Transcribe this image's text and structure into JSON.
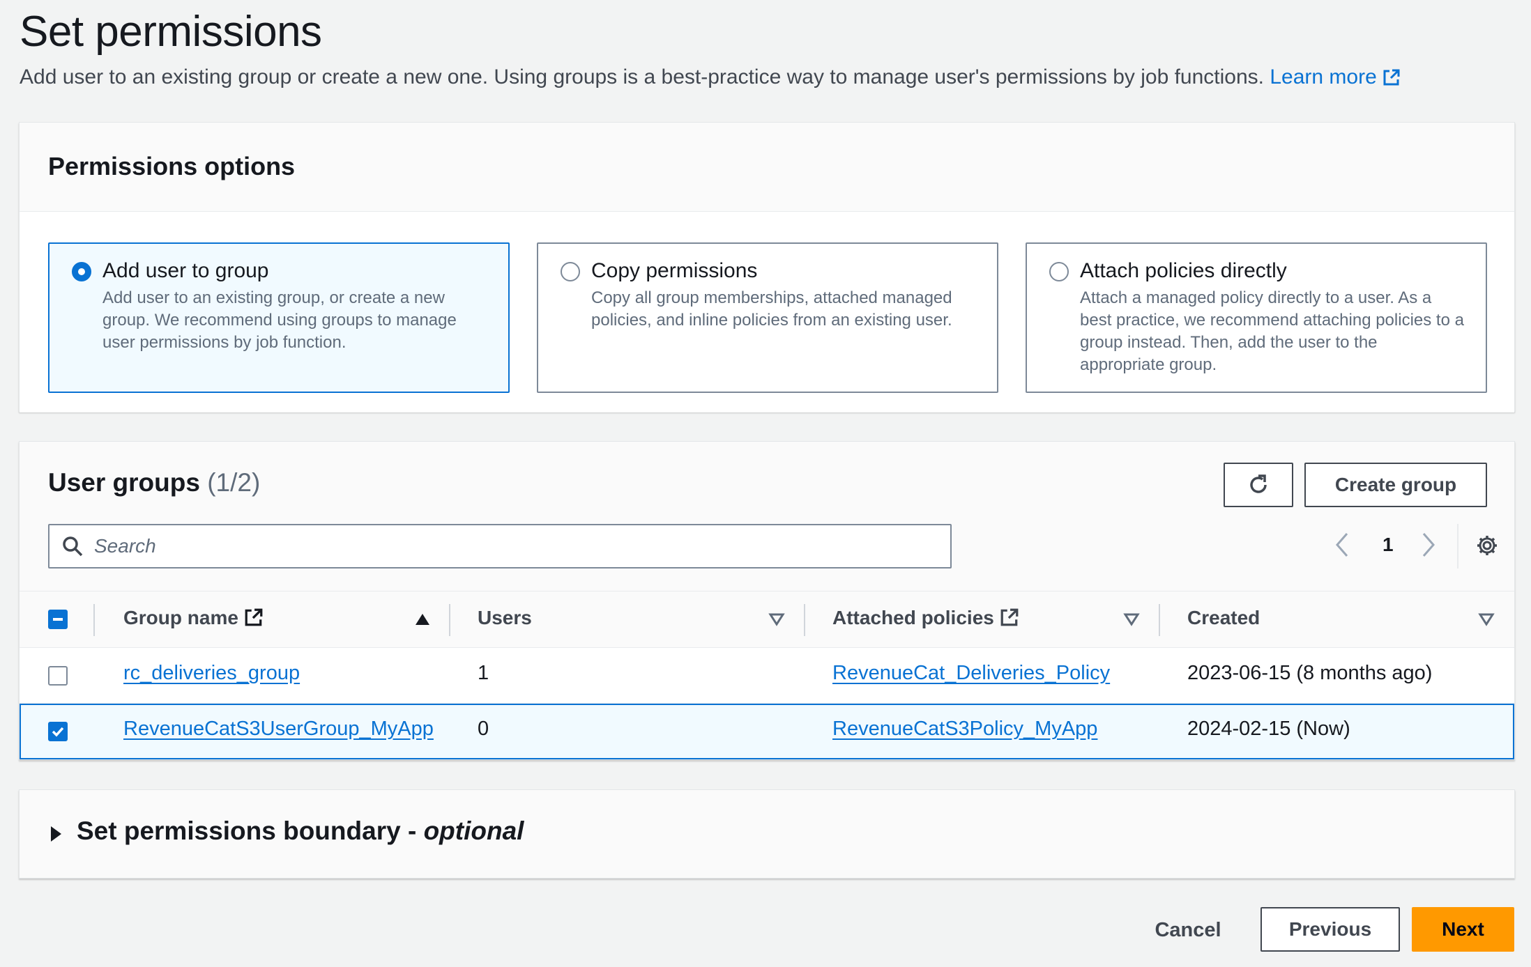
{
  "header": {
    "title": "Set permissions",
    "description": "Add user to an existing group or create a new one. Using groups is a best-practice way to manage user's permissions by job functions.",
    "learn_more": "Learn more"
  },
  "permissions_options": {
    "title": "Permissions options",
    "options": [
      {
        "title": "Add user to group",
        "description": "Add user to an existing group, or create a new group. We recommend using groups to manage user permissions by job function.",
        "selected": true
      },
      {
        "title": "Copy permissions",
        "description": "Copy all group memberships, attached managed policies, and inline policies from an existing user.",
        "selected": false
      },
      {
        "title": "Attach policies directly",
        "description": "Attach a managed policy directly to a user. As a best practice, we recommend attaching policies to a group instead. Then, add the user to the appropriate group.",
        "selected": false
      }
    ]
  },
  "user_groups": {
    "title": "User groups",
    "count": "(1/2)",
    "create_button": "Create group",
    "search_placeholder": "Search",
    "page": "1",
    "columns": [
      "Group name",
      "Users",
      "Attached policies",
      "Created"
    ],
    "rows": [
      {
        "group_name": "rc_deliveries_group",
        "users": "1",
        "policies": "RevenueCat_Deliveries_Policy",
        "created": "2023-06-15 (8 months ago)",
        "selected": false
      },
      {
        "group_name": "RevenueCatS3UserGroup_MyApp",
        "users": "0",
        "policies": "RevenueCatS3Policy_MyApp",
        "created": "2024-02-15 (Now)",
        "selected": true
      }
    ]
  },
  "boundary": {
    "title": "Set permissions boundary - ",
    "optional": "optional"
  },
  "footer": {
    "cancel": "Cancel",
    "previous": "Previous",
    "next": "Next"
  },
  "colors": {
    "accent": "#0972d3",
    "primary_button": "#ff9900",
    "selected_bg": "#f1faff"
  }
}
